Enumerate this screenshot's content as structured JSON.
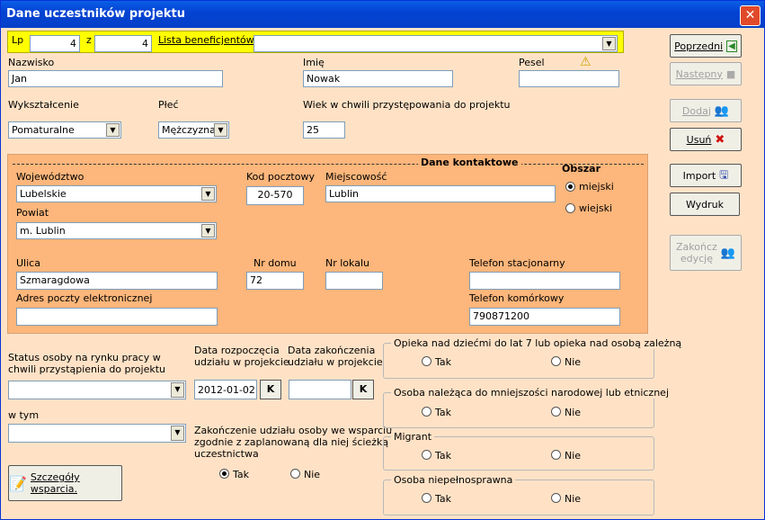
{
  "window": {
    "title": "Dane uczestników projektu"
  },
  "header": {
    "lp_label": "Lp",
    "lp_value": "4",
    "z_label": "z",
    "z_value": "4",
    "lista_label": "Lista beneficjentów",
    "lista_value": ""
  },
  "person": {
    "nazwisko_label": "Nazwisko",
    "nazwisko": "Jan",
    "imie_label": "Imię",
    "imie": "Nowak",
    "pesel_label": "Pesel",
    "pesel": "",
    "wyksztalcenie_label": "Wykształcenie",
    "wyksztalcenie": "Pomaturalne",
    "plec_label": "Płeć",
    "plec": "Mężczyzna",
    "wiek_label": "Wiek w chwili przystępowania do projektu",
    "wiek": "25"
  },
  "contact": {
    "title": "Dane kontaktowe",
    "wojewodztwo_label": "Województwo",
    "wojewodztwo": "Lubelskie",
    "kod_label": "Kod pocztowy",
    "kod": "20-570",
    "miejscowosc_label": "Miejscowość",
    "miejscowosc": "Lublin",
    "obszar_label": "Obszar",
    "obszar_opt1": "miejski",
    "obszar_opt2": "wiejski",
    "powiat_label": "Powiat",
    "powiat": "m. Lublin",
    "ulica_label": "Ulica",
    "ulica": "Szmaragdowa",
    "nr_domu_label": "Nr domu",
    "nr_domu": "72",
    "nr_lokalu_label": "Nr lokalu",
    "nr_lokalu": "",
    "tel_stac_label": "Telefon stacjonarny",
    "tel_stac": "",
    "email_label": "Adres poczty elektronicznej",
    "email": "",
    "tel_kom_label": "Telefon komórkowy",
    "tel_kom": "790871200"
  },
  "status": {
    "status_label_1": "Status osoby na rynku pracy w",
    "status_label_2": "chwili przystąpienia do projektu",
    "status": "",
    "w_tym_label": "w tym",
    "w_tym": "",
    "data_rozp_label_1": "Data rozpoczęcia",
    "data_rozp_label_2": "udziału w projekcie",
    "data_rozp": "2012-01-02",
    "data_zak_label_1": "Data zakończenia",
    "data_zak_label_2": "udziału w projekcie",
    "data_zak": "",
    "k_label": "K",
    "zak_label_1": "Zakończenie udziału osoby we wsparciu",
    "zak_label_2": "zgodnie z zaplanowaną dla niej ścieżką",
    "zak_label_3": "uczestnictwa",
    "tak": "Tak",
    "nie": "Nie"
  },
  "groups": {
    "opieka": "Opieka nad dziećmi do lat 7 lub opieka nad osobą zależną",
    "mniejszosc": "Osoba należąca do mniejszości narodowej lub etnicznej",
    "migrant": "Migrant",
    "niepelnosprawna": "Osoba niepełnosprawna"
  },
  "buttons": {
    "poprzedni": "Poprzedni",
    "nastepny": "Następny",
    "dodaj": "Dodaj",
    "usun": "Usuń",
    "import": "Import",
    "wydruk": "Wydruk",
    "zakoncz_1": "Zakończ",
    "zakoncz_2": "edycję",
    "szczegoly": "Szczegóły wsparcia."
  },
  "colors": {
    "titlebar": "#0443d3",
    "background": "#ffe2c6",
    "contact_panel": "#fdb67b",
    "highlight": "#ffff00"
  }
}
